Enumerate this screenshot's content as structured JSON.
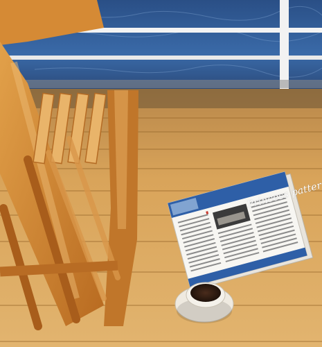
{
  "scene": {
    "newsletter_title": "Princess patter"
  },
  "colors": {
    "sea": "#2f5f9a",
    "railing": "#f3f3f3",
    "deck": "#d9a45a",
    "chair": "#c87b2a",
    "newsletter_header": "#2e5fa7",
    "coffee": "#3a2418"
  },
  "icons": {
    "chair": "deck-chair",
    "cup": "coffee-cup-icon"
  }
}
